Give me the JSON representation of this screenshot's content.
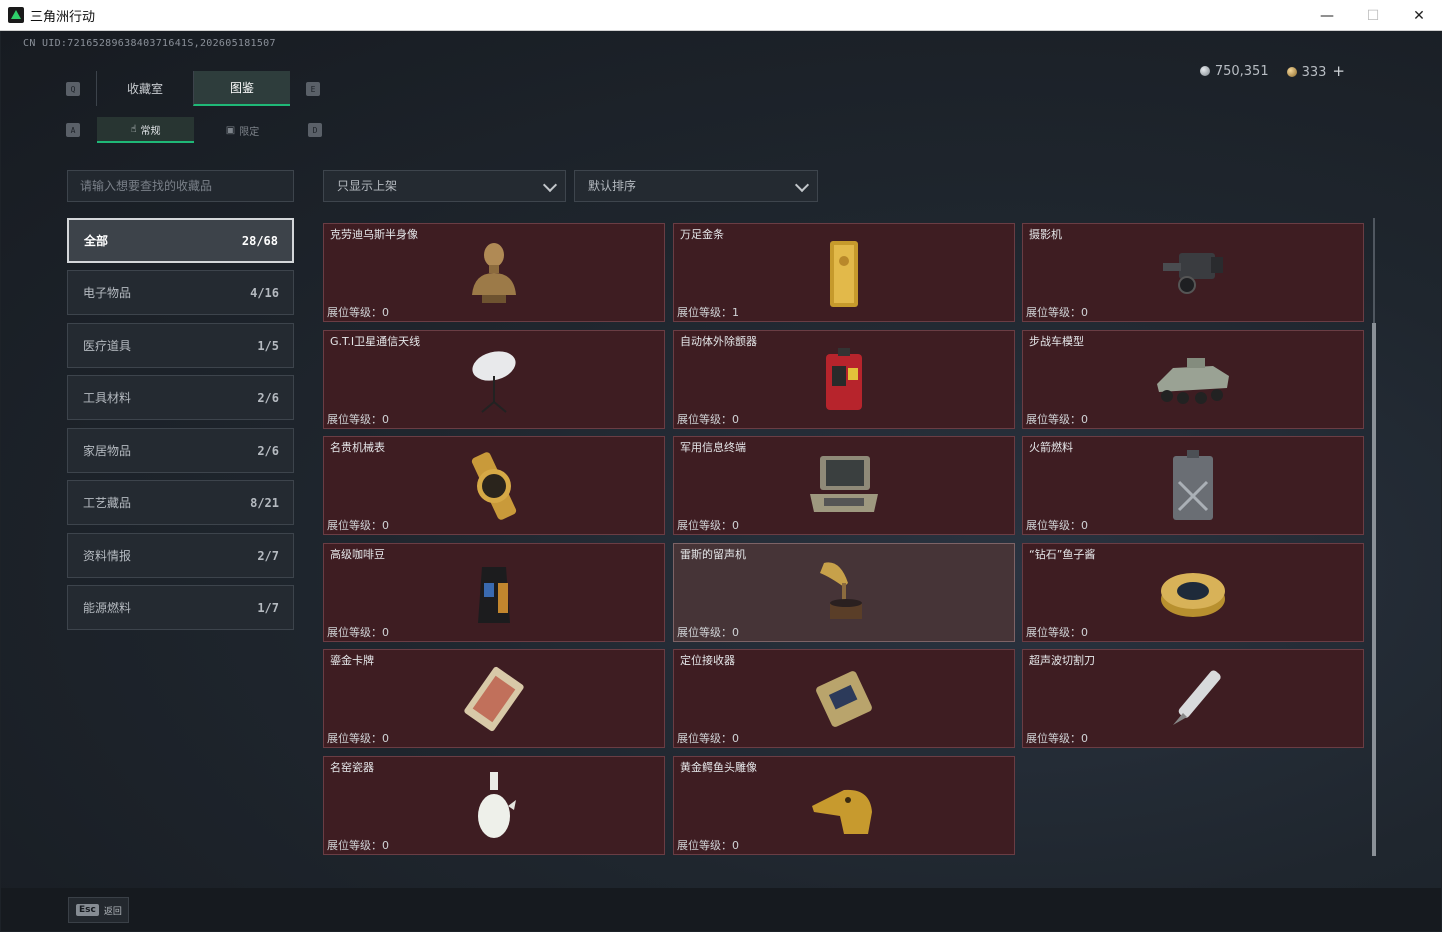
{
  "window": {
    "title": "三角洲行动",
    "minimize": "—",
    "maximize": "☐",
    "close": "✕"
  },
  "uid": "CN UID:7216528963840371641S,202605181507",
  "currency": {
    "silver": "750,351",
    "gold": "333",
    "plus": "+"
  },
  "keys": {
    "tab_left": "Q",
    "tab_right": "E",
    "sub_left": "A",
    "sub_right": "D"
  },
  "tabs": [
    {
      "label": "收藏室"
    },
    {
      "label": "图鉴"
    }
  ],
  "subtabs": [
    {
      "label": "常规"
    },
    {
      "label": "限定"
    }
  ],
  "search": {
    "placeholder": "请输入想要查找的收藏品"
  },
  "filters": {
    "display": "只显示上架",
    "sort": "默认排序"
  },
  "categories": [
    {
      "label": "全部",
      "count": "28/68"
    },
    {
      "label": "电子物品",
      "count": "4/16"
    },
    {
      "label": "医疗道具",
      "count": "1/5"
    },
    {
      "label": "工具材料",
      "count": "2/6"
    },
    {
      "label": "家居物品",
      "count": "2/6"
    },
    {
      "label": "工艺藏品",
      "count": "8/21"
    },
    {
      "label": "资料情报",
      "count": "2/7"
    },
    {
      "label": "能源燃料",
      "count": "1/7"
    }
  ],
  "items": [
    {
      "name": "克劳迪乌斯半身像",
      "level": "展位等级：0",
      "icon": "bust-icon"
    },
    {
      "name": "万足金条",
      "level": "展位等级：1",
      "icon": "gold-bar-icon"
    },
    {
      "name": "摄影机",
      "level": "展位等级：0",
      "icon": "camera-icon"
    },
    {
      "name": "G.T.I卫星通信天线",
      "level": "展位等级：0",
      "icon": "satellite-dish-icon"
    },
    {
      "name": "自动体外除颤器",
      "level": "展位等级：0",
      "icon": "defibrillator-icon"
    },
    {
      "name": "步战车模型",
      "level": "展位等级：0",
      "icon": "ifv-model-icon"
    },
    {
      "name": "名贵机械表",
      "level": "展位等级：0",
      "icon": "watch-icon"
    },
    {
      "name": "军用信息终端",
      "level": "展位等级：0",
      "icon": "terminal-icon"
    },
    {
      "name": "火箭燃料",
      "level": "展位等级：0",
      "icon": "fuel-can-icon"
    },
    {
      "name": "高级咖啡豆",
      "level": "展位等级：0",
      "icon": "coffee-bag-icon"
    },
    {
      "name": "雷斯的留声机",
      "level": "展位等级：0",
      "icon": "gramophone-icon"
    },
    {
      "name": "“钻石”鱼子酱",
      "level": "展位等级：0",
      "icon": "caviar-tin-icon"
    },
    {
      "name": "鎏金卡牌",
      "level": "展位等级：0",
      "icon": "gilded-card-icon"
    },
    {
      "name": "定位接收器",
      "level": "展位等级：0",
      "icon": "gps-receiver-icon"
    },
    {
      "name": "超声波切割刀",
      "level": "展位等级：0",
      "icon": "ultrasonic-cutter-icon"
    },
    {
      "name": "名窑瓷器",
      "level": "展位等级：0",
      "icon": "porcelain-vase-icon"
    },
    {
      "name": "黄金鳄鱼头雕像",
      "level": "展位等级：0",
      "icon": "croc-head-statue-icon"
    }
  ],
  "footer": {
    "esc_key": "Esc",
    "esc_label": "返回"
  }
}
